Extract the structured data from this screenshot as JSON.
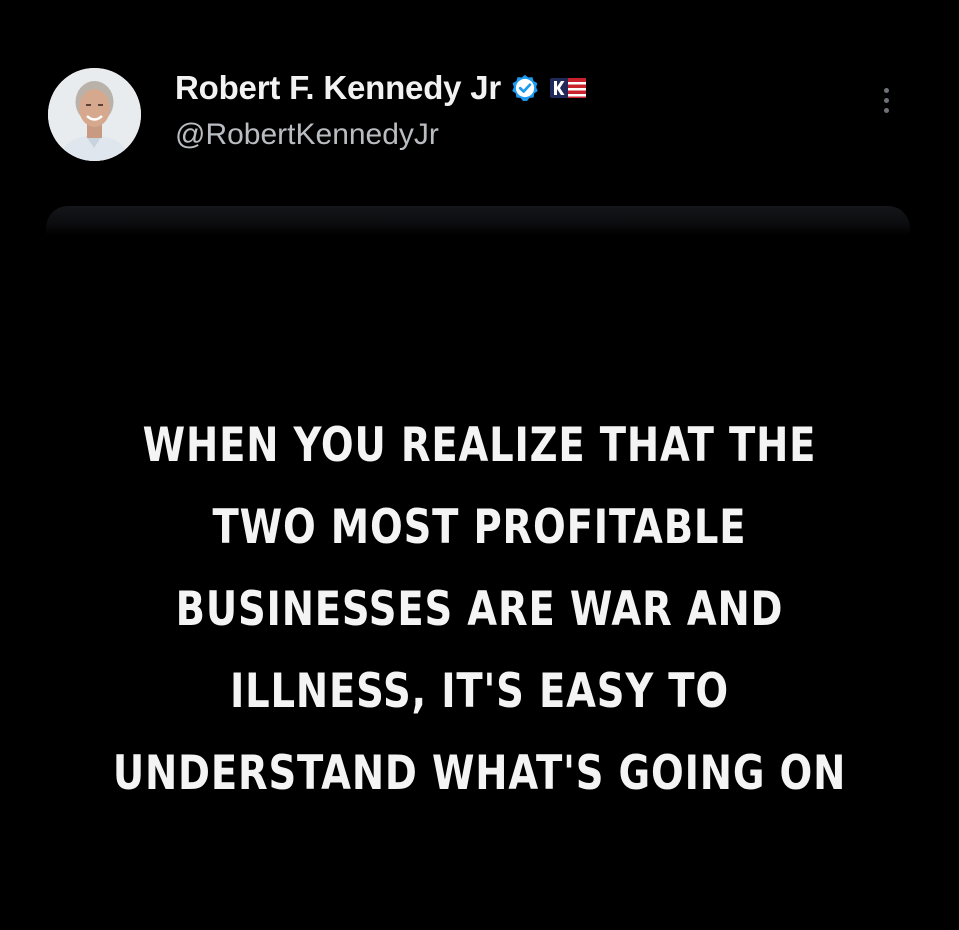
{
  "tweet": {
    "author": {
      "display_name": "Robert F. Kennedy Jr",
      "handle": "@RobertKennedyJr",
      "verified": true,
      "badge_icon": "kennedy-campaign-flag-icon",
      "avatar_icon": "profile-photo"
    },
    "more_icon": "more-vertical-icon",
    "image_text_lines": [
      "WHEN YOU REALIZE THAT THE",
      "TWO MOST PROFITABLE",
      "BUSINESSES ARE WAR AND",
      "ILLNESS, IT'S EASY TO",
      "UNDERSTAND WHAT'S GOING ON"
    ]
  },
  "colors": {
    "background": "#000000",
    "name": "#f2f2f2",
    "handle": "#b9bcc0",
    "verified_blue": "#1d9bf0",
    "quote_text": "#f4f4f4"
  }
}
